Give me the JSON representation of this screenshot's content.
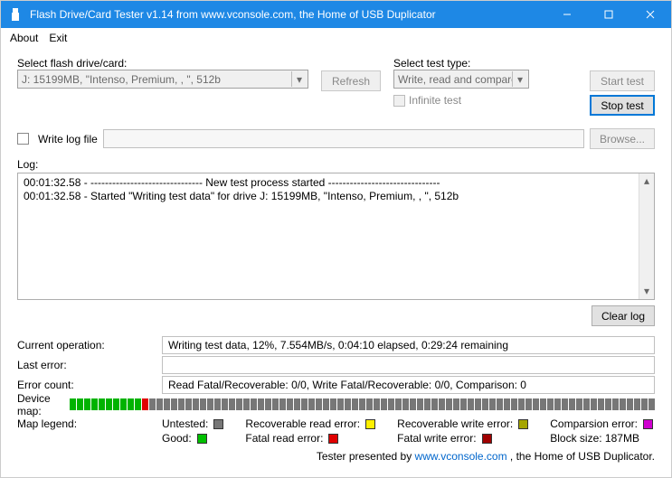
{
  "window": {
    "title": "Flash Drive/Card Tester v1.14 from www.vconsole.com, the Home of USB Duplicator"
  },
  "menu": {
    "about": "About",
    "exit": "Exit"
  },
  "topRow": {
    "driveLabel": "Select flash drive/card:",
    "driveValue": "J: 15199MB, \"Intenso, Premium, , \", 512b",
    "refresh": "Refresh",
    "testTypeLabel": "Select test type:",
    "testTypeValue": "Write, read and compare",
    "infinite": "Infinite test",
    "startTest": "Start test",
    "stopTest": "Stop test"
  },
  "logFile": {
    "checkboxLabel": "Write log file",
    "browse": "Browse..."
  },
  "log": {
    "label": "Log:",
    "lines": [
      "00:01:32.58 - ------------------------------- New test process started -------------------------------",
      "00:01:32.58 - Started \"Writing test data\" for drive J: 15199MB, \"Intenso, Premium, , \", 512b"
    ],
    "clear": "Clear log"
  },
  "status": {
    "currentOpLabel": "Current operation:",
    "currentOpValue": "Writing test data, 12%, 7.554MB/s, 0:04:10 elapsed, 0:29:24 remaining",
    "lastErrorLabel": "Last error:",
    "lastErrorValue": "",
    "errorCountLabel": "Error count:",
    "errorCountValue": "Read Fatal/Recoverable: 0/0, Write Fatal/Recoverable: 0/0, Comparison: 0",
    "deviceMapLabel": "Device map:",
    "deviceMap": {
      "green": 10,
      "red": 1,
      "grey": 70
    }
  },
  "legend": {
    "label": "Map legend:",
    "untested": "Untested:",
    "good": "Good:",
    "recoverableRead": "Recoverable read error:",
    "fatalRead": "Fatal read error:",
    "recoverableWrite": "Recoverable write error:",
    "fatalWrite": "Fatal write error:",
    "comparison": "Comparsion error:",
    "blockSize": "Block size: 187MB"
  },
  "footer": {
    "prefix": "Tester presented by ",
    "link": "www.vconsole.com",
    "suffix": " , the Home of USB Duplicator."
  }
}
